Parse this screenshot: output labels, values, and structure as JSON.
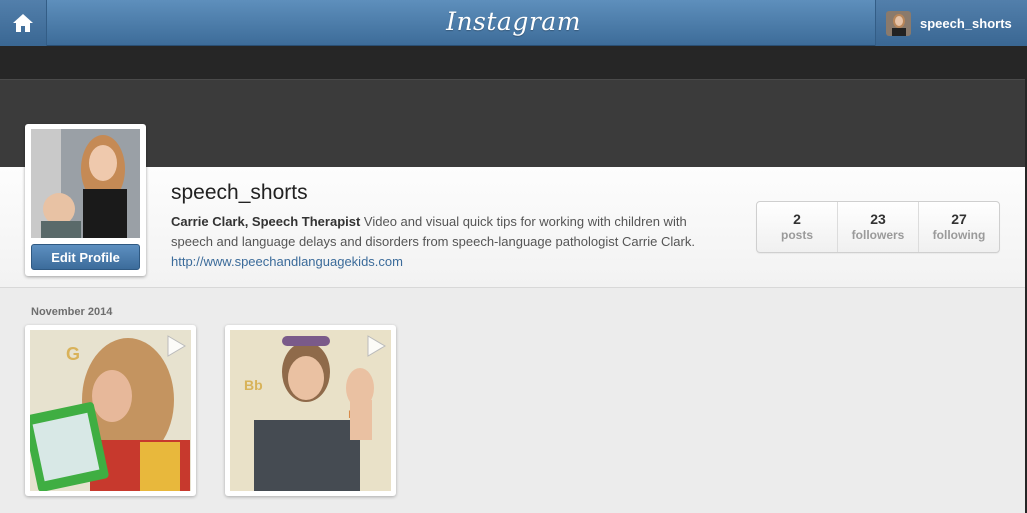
{
  "topbar": {
    "logo": "Instagram",
    "home_icon": "home-icon",
    "username": "speech_shorts"
  },
  "profile": {
    "username": "speech_shorts",
    "full_name": "Carrie Clark, Speech Therapist",
    "bio": " Video and visual quick tips for working with children with speech and language delays and disorders from speech-language pathologist Carrie Clark. ",
    "website": "http://www.speechandlanguagekids.com",
    "edit_button": "Edit Profile"
  },
  "stats": [
    {
      "value": "2",
      "label": "posts"
    },
    {
      "value": "23",
      "label": "followers"
    },
    {
      "value": "27",
      "label": "following"
    }
  ],
  "feed": {
    "month": "November 2014",
    "posts": [
      {
        "type": "video",
        "icon": "play-icon"
      },
      {
        "type": "video",
        "icon": "play-icon"
      }
    ]
  },
  "colors": {
    "topbar": "#4a7aa7",
    "accent": "#3b6b9a",
    "band": "#3b3b3b",
    "background": "#262626"
  }
}
